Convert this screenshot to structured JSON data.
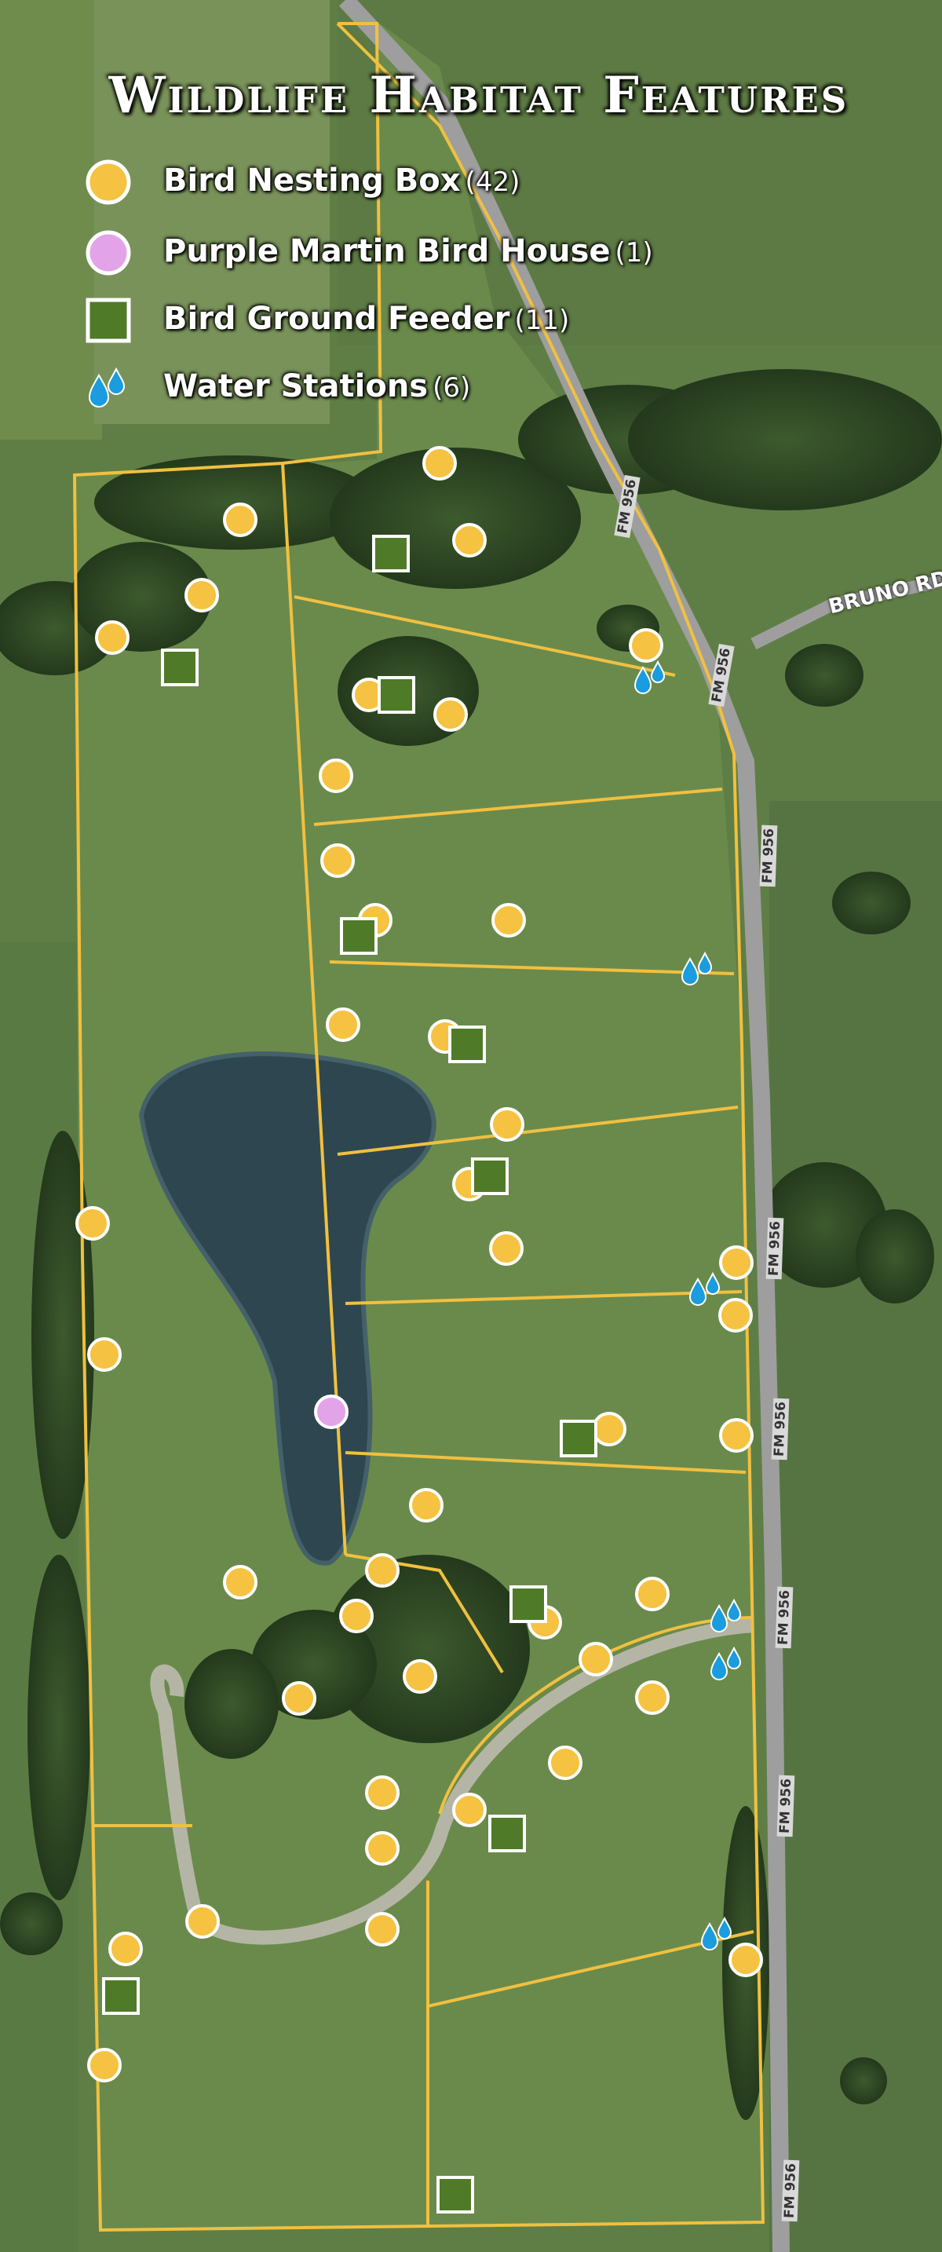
{
  "title": "Wildlife Habitat Features",
  "legend": [
    {
      "name": "nesting",
      "label": "Bird Nesting Box",
      "count": "(42)",
      "color": "#f5c242"
    },
    {
      "name": "martin",
      "label": "Purple Martin Bird House",
      "count": "(1)",
      "color": "#e3a3e8"
    },
    {
      "name": "feeder",
      "label": "Bird Ground Feeder",
      "count": "(11)",
      "color": "#4f7a28"
    },
    {
      "name": "water",
      "label": "Water Stations",
      "count": "(6)",
      "color": "#1a9cde"
    }
  ],
  "roads": {
    "fm956": "FM 956",
    "bruno": "BRUNO RD"
  },
  "colors": {
    "boundary": "#f0c040",
    "pasture": "#6a8a4c",
    "woods": "#2f4a25",
    "pond": "#2e4650",
    "road": "#a9a9a9"
  }
}
